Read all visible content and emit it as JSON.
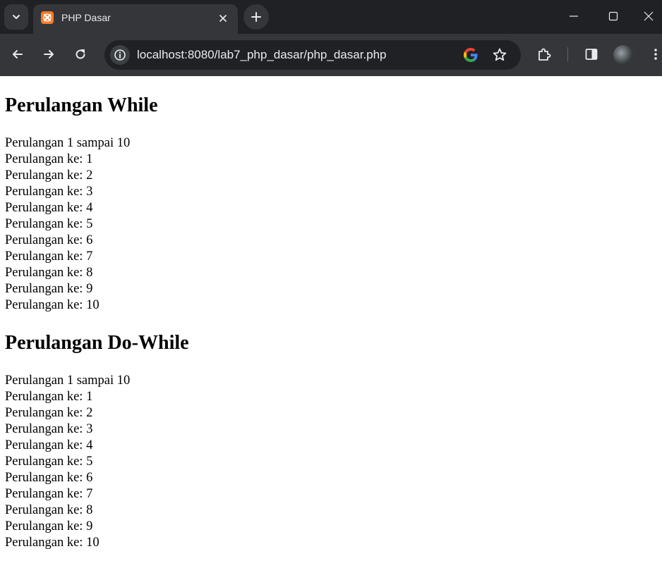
{
  "browser": {
    "tab_title": "PHP Dasar",
    "url": "localhost:8080/lab7_php_dasar/php_dasar.php"
  },
  "sections": [
    {
      "heading": "Perulangan While",
      "lines": [
        "Perulangan 1 sampai 10",
        "Perulangan ke: 1",
        "Perulangan ke: 2",
        "Perulangan ke: 3",
        "Perulangan ke: 4",
        "Perulangan ke: 5",
        "Perulangan ke: 6",
        "Perulangan ke: 7",
        "Perulangan ke: 8",
        "Perulangan ke: 9",
        "Perulangan ke: 10"
      ]
    },
    {
      "heading": "Perulangan Do-While",
      "lines": [
        "Perulangan 1 sampai 10",
        "Perulangan ke: 1",
        "Perulangan ke: 2",
        "Perulangan ke: 3",
        "Perulangan ke: 4",
        "Perulangan ke: 5",
        "Perulangan ke: 6",
        "Perulangan ke: 7",
        "Perulangan ke: 8",
        "Perulangan ke: 9",
        "Perulangan ke: 10"
      ]
    }
  ],
  "colors": {
    "chrome_dark": "#202124",
    "chrome_toolbar": "#35363a",
    "favicon_orange": "#fb7a24",
    "text_light": "#e8eaed"
  }
}
